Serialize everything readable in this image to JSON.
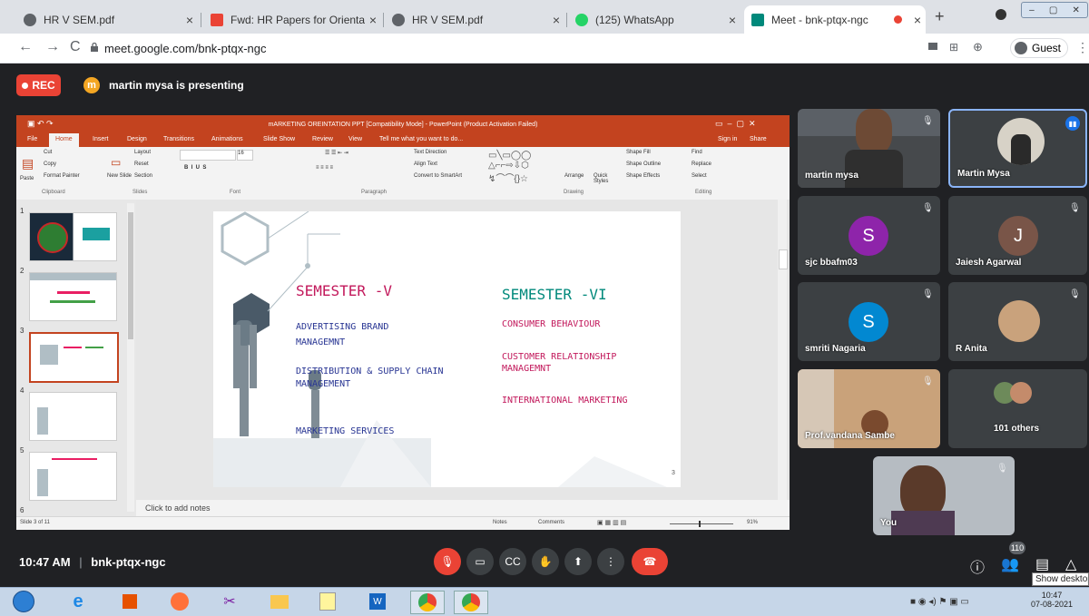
{
  "browser": {
    "tabs": [
      {
        "title": "HR V SEM.pdf",
        "icon": "globe-icon",
        "color": "#5f6368"
      },
      {
        "title": "Fwd: HR Papers for Orientation",
        "icon": "gmail-icon",
        "color": "#ea4335"
      },
      {
        "title": "HR V SEM.pdf",
        "icon": "globe-icon",
        "color": "#5f6368"
      },
      {
        "title": "(125) WhatsApp",
        "icon": "whatsapp-icon",
        "color": "#25d366"
      },
      {
        "title": "Meet - bnk-ptqx-ngc",
        "icon": "meet-icon",
        "color": "#00897b"
      }
    ],
    "url": "meet.google.com/bnk-ptqx-ngc",
    "profile_label": "Guest"
  },
  "meet": {
    "rec_label": "REC",
    "presenter_initial": "m",
    "presenter_text": "martin mysa is presenting",
    "time": "10:47 AM",
    "separator": "|",
    "meeting_code": "bnk-ptqx-ngc",
    "participant_count": "110",
    "tiles": [
      {
        "name": "martin mysa"
      },
      {
        "name": "Martin Mysa"
      },
      {
        "name": "sjc bbafm03",
        "initial": "S",
        "color": "#8e24aa"
      },
      {
        "name": "Jaiesh Agarwal",
        "initial": "J",
        "color": "#795548"
      },
      {
        "name": "smriti Nagaria",
        "initial": "S",
        "color": "#0288d1"
      },
      {
        "name": "R Anita"
      },
      {
        "name": "Prof.vandana Sambe"
      },
      {
        "name": "101 others"
      },
      {
        "name": "You"
      }
    ]
  },
  "ppt": {
    "title": "mARKETING OREINTATION PPT [Compatibility Mode] - PowerPoint (Product Activation Failed)",
    "menu": [
      "File",
      "Home",
      "Insert",
      "Design",
      "Transitions",
      "Animations",
      "Slide Show",
      "Review",
      "View",
      "Tell me what you want to do..."
    ],
    "sign_in": "Sign in",
    "share": "Share",
    "ribbon": {
      "paste": "Paste",
      "cut": "Cut",
      "copy": "Copy",
      "format_painter": "Format Painter",
      "clipboard": "Clipboard",
      "new_slide": "New Slide",
      "layout": "Layout",
      "reset": "Reset",
      "section": "Section",
      "slides": "Slides",
      "font": "Font",
      "paragraph": "Paragraph",
      "text_direction": "Text Direction",
      "align_text": "Align Text",
      "convert_smartart": "Convert to SmartArt",
      "drawing": "Drawing",
      "arrange": "Arrange",
      "quick_styles": "Quick Styles",
      "shape_fill": "Shape Fill",
      "shape_outline": "Shape Outline",
      "shape_effects": "Shape Effects",
      "find": "Find",
      "replace": "Replace",
      "select": "Select",
      "editing": "Editing",
      "font_size": "16"
    },
    "thumb_numbers": [
      "1",
      "2",
      "3",
      "4",
      "5",
      "6"
    ],
    "slide": {
      "sem5_title": "SEMESTER -V",
      "sem5_items": [
        "ADVERTISING BRAND MANAGEMNT",
        "DISTRIBUTION & SUPPLY CHAIN MANAGEMENT",
        "MARKETING SERVICES"
      ],
      "sem6_title": "SEMESTER -VI",
      "sem6_items": [
        "CONSUMER BEHAVIOUR",
        "CUSTOMER RELATIONSHIP MANAGEMNT",
        "INTERNATIONAL MARKETING"
      ],
      "page_number": "3"
    },
    "notes_placeholder": "Click to add notes",
    "status_slide": "Slide 3 of 11",
    "status_notes": "Notes",
    "status_comments": "Comments",
    "zoom": "91%"
  },
  "taskbar": {
    "time": "10:47",
    "date": "07-08-2021",
    "tooltip": "Show desktop"
  }
}
